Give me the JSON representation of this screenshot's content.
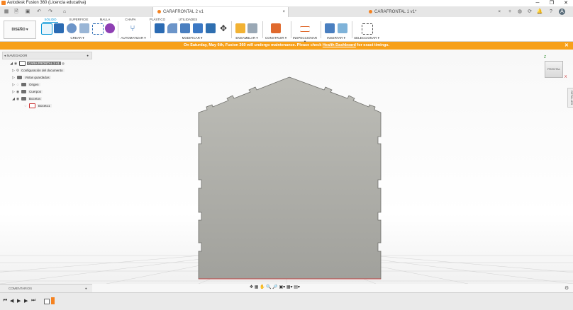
{
  "window": {
    "title": "Autodesk Fusion 360 (Licencia educativa)",
    "controls": [
      "─",
      "❐",
      "✕"
    ]
  },
  "tabs": {
    "active": "CARAFRONTAL 2 v1",
    "inactive": "CARAFRONTAL 1 v1*",
    "close": "×",
    "add": "+"
  },
  "toolbar": {
    "workspace": "DISEÑO ▾",
    "tabs": [
      "SÓLIDO",
      "SUPERFICIE",
      "MALLA",
      "CHAPA",
      "PLÁSTICO",
      "UTILIDADES"
    ],
    "groups": [
      "CREAR ▾",
      "AUTOMATIZAR ▾",
      "MODIFICAR ▾",
      "ENSAMBLAR ▾",
      "CONSTRUIR ▾",
      "INSPECCIONAR ▾",
      "INSERTAR ▾",
      "SELECCIONAR ▾"
    ],
    "notification_count": "1"
  },
  "banner": {
    "text": "On Saturday, May 6th, Fusion 360 will undergo maintenance. Please check ",
    "link": "Health Dashboard",
    "suffix": " for exact timings.",
    "close": "✕"
  },
  "browser": {
    "title": "NAVEGADOR",
    "root": "CARA FRONTAL 2 v1",
    "items": [
      "Configuración del documento",
      "Vistas guardadas",
      "Origen",
      "Cuerpos",
      "Bocetos"
    ],
    "sketch": "Boceto1"
  },
  "viewcube": {
    "label": "FRONTAL",
    "z": "Z",
    "x": "X"
  },
  "side_panel": "DETALLES",
  "comments": {
    "label": "COMENTARIOS"
  },
  "colors": {
    "accent": "#0696d7",
    "banner": "#f7a019",
    "part": "#a9a9a4"
  }
}
